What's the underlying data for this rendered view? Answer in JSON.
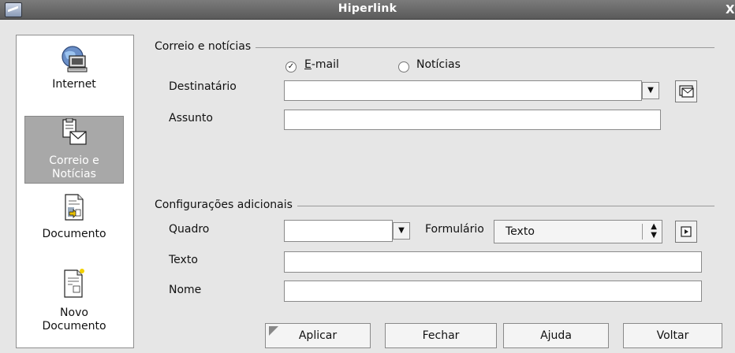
{
  "window": {
    "title": "Hiperlink",
    "close_label": "X"
  },
  "sidebar": {
    "items": [
      {
        "label": "Internet",
        "icon": "globe-computer-icon"
      },
      {
        "label_line1": "Correio e",
        "label_line2": "Notícias",
        "icon": "mail-news-icon",
        "selected": true
      },
      {
        "label": "Documento",
        "icon": "document-icon"
      },
      {
        "label_line1": "Novo",
        "label_line2": "Documento",
        "icon": "new-document-icon"
      }
    ]
  },
  "mail_group": {
    "title": "Correio e notícias",
    "email_radio": {
      "label": "E-mail",
      "checked": true
    },
    "news_radio": {
      "label": "Notícias",
      "checked": false
    },
    "recipient_label": "Destinatário",
    "recipient_value": "",
    "subject_label": "Assunto",
    "subject_value": ""
  },
  "additional_group": {
    "title": "Configurações adicionais",
    "frame_label": "Quadro",
    "frame_value": "",
    "form_label": "Formulário",
    "form_value": "Texto",
    "text_label": "Texto",
    "text_value": "",
    "name_label": "Nome",
    "name_value": ""
  },
  "buttons": {
    "apply": "Aplicar",
    "close": "Fechar",
    "help": "Ajuda",
    "back": "Voltar"
  }
}
